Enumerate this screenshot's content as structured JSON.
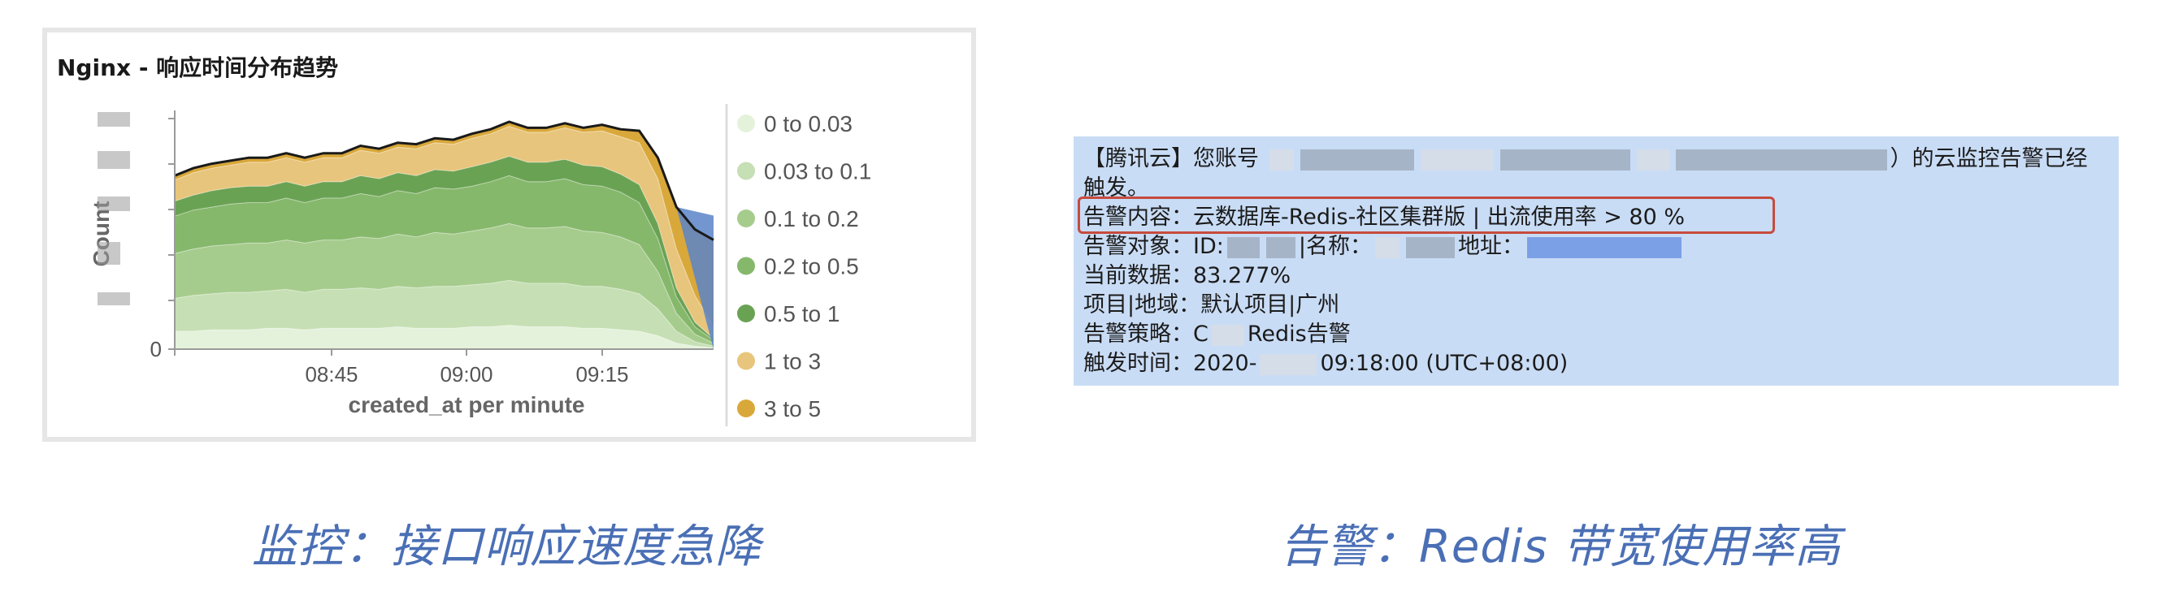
{
  "left_panel": {
    "title": "Nginx - 响应时间分布趋势",
    "caption": "监控：接口响应速度急降"
  },
  "chart_data": {
    "type": "area",
    "title": "Nginx - 响应时间分布趋势",
    "xlabel": "created_at per minute",
    "ylabel": "Count",
    "x_ticks": [
      "08:45",
      "09:00",
      "09:15"
    ],
    "y_ticks": [
      "0"
    ],
    "stacked": true,
    "legend_position": "right",
    "series": [
      {
        "name": "0 to 0.03",
        "color": "#e4f2dc",
        "values": [
          12,
          12,
          13,
          13,
          13,
          14,
          14,
          13,
          14,
          14,
          14,
          14,
          15,
          14,
          14,
          14,
          15,
          15,
          16,
          15,
          15,
          15,
          14,
          14,
          13,
          12,
          9,
          4,
          2,
          1
        ]
      },
      {
        "name": "0.03 to 0.1",
        "color": "#c6dfb4",
        "values": [
          22,
          24,
          24,
          25,
          25,
          25,
          26,
          25,
          26,
          26,
          27,
          26,
          27,
          27,
          28,
          28,
          28,
          29,
          30,
          29,
          29,
          29,
          28,
          28,
          27,
          25,
          18,
          8,
          3,
          1
        ]
      },
      {
        "name": "0.1 to 0.2",
        "color": "#a6cc8d",
        "values": [
          30,
          31,
          32,
          32,
          33,
          32,
          33,
          33,
          33,
          33,
          34,
          34,
          35,
          34,
          36,
          35,
          36,
          37,
          38,
          37,
          37,
          38,
          37,
          36,
          35,
          33,
          25,
          12,
          5,
          2
        ]
      },
      {
        "name": "0.2 to 0.5",
        "color": "#86b86c",
        "values": [
          25,
          26,
          26,
          27,
          27,
          27,
          28,
          27,
          28,
          28,
          29,
          28,
          29,
          29,
          30,
          30,
          30,
          31,
          32,
          31,
          31,
          32,
          31,
          31,
          30,
          28,
          22,
          11,
          5,
          2
        ]
      },
      {
        "name": "0.5 to 1",
        "color": "#6aa254",
        "values": [
          10,
          10,
          11,
          11,
          11,
          11,
          11,
          11,
          11,
          11,
          12,
          12,
          12,
          12,
          12,
          12,
          13,
          13,
          13,
          13,
          13,
          13,
          13,
          13,
          12,
          12,
          10,
          6,
          3,
          1
        ]
      },
      {
        "name": "1 to 3",
        "color": "#e8c57c",
        "values": [
          14,
          15,
          15,
          15,
          16,
          16,
          16,
          16,
          16,
          16,
          17,
          17,
          17,
          18,
          18,
          18,
          19,
          19,
          20,
          20,
          20,
          21,
          22,
          24,
          25,
          28,
          30,
          26,
          18,
          8
        ]
      },
      {
        "name": "3 to 5",
        "color": "#d9a83a",
        "values": [
          3,
          3,
          3,
          3,
          3,
          3,
          3,
          3,
          3,
          3,
          3,
          3,
          3,
          3,
          3,
          3,
          3,
          3,
          3,
          3,
          3,
          3,
          3,
          4,
          5,
          8,
          14,
          28,
          44,
          58
        ]
      }
    ],
    "tail_series_color": "#5b84c8"
  },
  "right_panel": {
    "lines": [
      {
        "prefix": "【腾讯云】您账号",
        "suffix": "）的云监控告警已经"
      },
      {
        "text": "触发。"
      },
      {
        "text": "告警内容：云数据库-Redis-社区集群版 | 出流使用率 >  80 %"
      },
      {
        "prefix": "告警对象：ID:",
        "mid": "|名称：",
        "suffix": "地址："
      },
      {
        "text": "当前数据：83.277%"
      },
      {
        "text": "项目|地域：默认项目|广州"
      },
      {
        "prefix": "告警策略：C",
        "suffix": "Redis告警"
      },
      {
        "prefix": "触发时间：2020-",
        "suffix": "09:18:00 (UTC+08:00)"
      }
    ],
    "caption": "告警：Redis 带宽使用率高"
  },
  "colors": {
    "alert_background": "#c9dcf5",
    "highlight_border": "#c64b3d",
    "caption": "#4a6fb5"
  }
}
